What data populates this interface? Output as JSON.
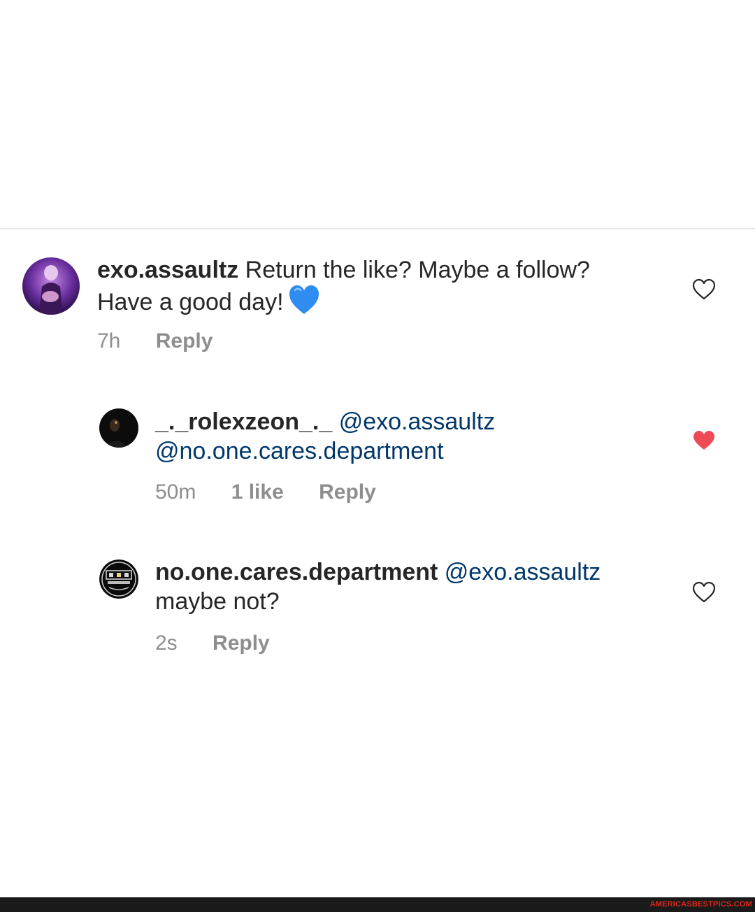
{
  "comments": [
    {
      "username": "exo.assaultz",
      "text_line1": "Return the like? Maybe a follow?",
      "text_line2": "Have a good day!",
      "emoji": "blue-heart",
      "time": "7h",
      "reply_label": "Reply",
      "liked": false
    },
    {
      "username": "_._rolexzeon_._",
      "mention1": "@exo.assaultz",
      "mention2": "@no.one.cares.department",
      "time": "50m",
      "likes_label": "1 like",
      "reply_label": "Reply",
      "liked": true
    },
    {
      "username": "no.one.cares.department",
      "mention1": "@exo.assaultz",
      "text_line2": "maybe not?",
      "time": "2s",
      "reply_label": "Reply",
      "liked": false
    }
  ],
  "footer": {
    "brand": "AMERICASBESTPICS.COM"
  },
  "colors": {
    "mention": "#00376b",
    "meta": "#8e8e8e",
    "liked_heart": "#ed4956",
    "emoji_heart": "#2f8cf0",
    "footer_bar": "#1a1a1a",
    "footer_brand": "#e0251b"
  }
}
